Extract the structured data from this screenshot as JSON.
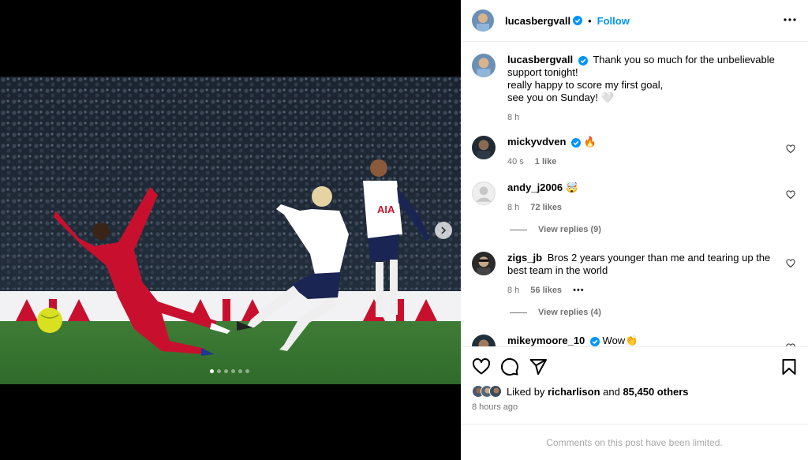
{
  "header": {
    "username": "lucasbergvall",
    "separator": "•",
    "follow_label": "Follow"
  },
  "caption": {
    "username": "lucasbergvall",
    "text": "Thank you so much for the unbelievable support tonight!\nreally happy to score my first goal,\nsee you on Sunday! 🤍",
    "time": "8 h"
  },
  "comments": [
    {
      "username": "mickyvdven",
      "verified": true,
      "text": "🔥",
      "time": "40 s",
      "likes": "1 like"
    },
    {
      "username": "andy_j2006",
      "verified": false,
      "text": "🤯",
      "time": "8 h",
      "likes": "72 likes",
      "replies": "View replies (9)"
    },
    {
      "username": "zigs_jb",
      "verified": false,
      "text": "Bros 2 years younger than me and tearing up the best team in the world",
      "time": "8 h",
      "likes": "56 likes",
      "more": "•••",
      "replies": "View replies (4)"
    },
    {
      "username": "mikeymoore_10",
      "verified": true,
      "text": "Wow👏"
    }
  ],
  "likes": {
    "prefix": "Liked by ",
    "user": "richarlison",
    "middle": " and ",
    "count": "85,450 others"
  },
  "time_ago": "8 hours ago",
  "limited_text": "Comments on this post have been limited.",
  "carousel": {
    "slides": 6,
    "active": 0
  },
  "colors": {
    "link": "#0095f6",
    "verified": "#0095f6",
    "secondary": "#737373"
  },
  "icons": [
    "verified-badge-icon",
    "more-options-icon",
    "heart-icon",
    "comment-icon",
    "share-icon",
    "bookmark-icon",
    "chevron-right-icon"
  ]
}
